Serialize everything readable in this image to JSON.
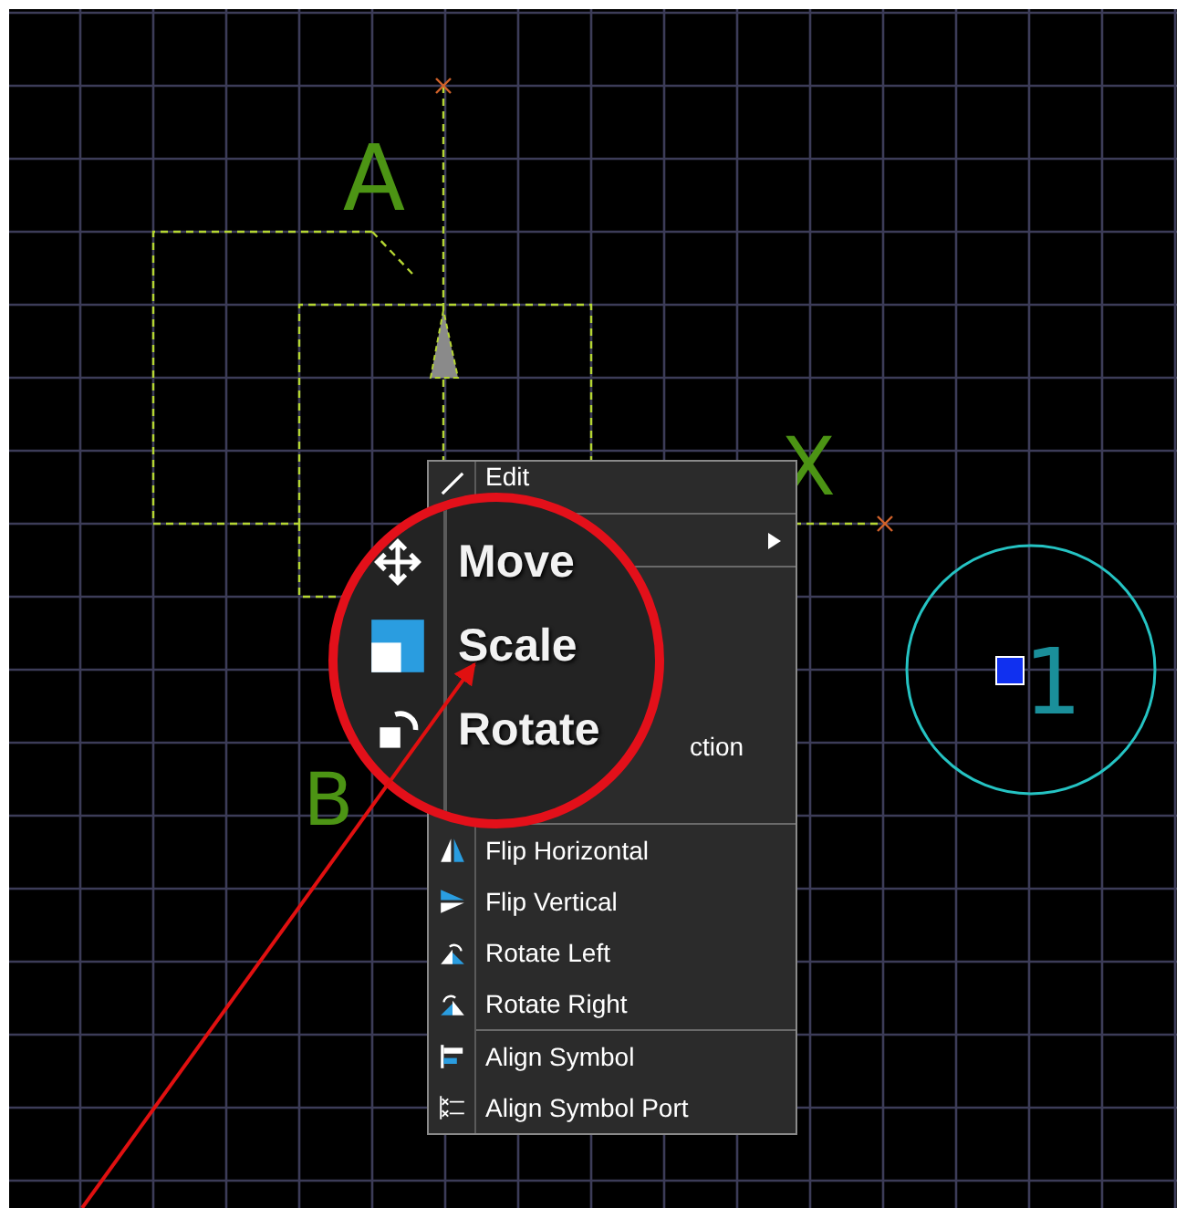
{
  "canvas": {
    "labels": [
      {
        "text": "A",
        "kind": "pin-label"
      },
      {
        "text": "X",
        "kind": "pin-label"
      },
      {
        "text": "B",
        "kind": "pin-label"
      }
    ],
    "port": {
      "text": "1"
    }
  },
  "context_menu": {
    "items": [
      {
        "kind": "item",
        "label": "Edit"
      },
      {
        "kind": "separator"
      },
      {
        "kind": "covered",
        "submenu": true
      },
      {
        "kind": "separator"
      },
      {
        "kind": "covered-block"
      },
      {
        "kind": "fragment",
        "label": "ction"
      },
      {
        "kind": "covered"
      },
      {
        "kind": "separator"
      },
      {
        "kind": "item",
        "label": "Flip Horizontal"
      },
      {
        "kind": "item",
        "label": "Flip Vertical"
      },
      {
        "kind": "item",
        "label": "Rotate Left"
      },
      {
        "kind": "item",
        "label": "Rotate Right"
      },
      {
        "kind": "separator"
      },
      {
        "kind": "item",
        "label": "Align Symbol"
      },
      {
        "kind": "item",
        "label": "Align Symbol Port"
      }
    ]
  },
  "magnifier": {
    "items": [
      {
        "label": "Move"
      },
      {
        "label": "Scale"
      },
      {
        "label": "Rotate"
      }
    ]
  }
}
